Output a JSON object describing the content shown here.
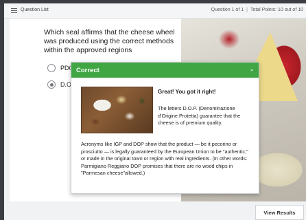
{
  "header": {
    "question_list_label": "Question List",
    "question_counter": "Question 1 of 1",
    "total_points": "Total Points: 10 out of 10"
  },
  "question": {
    "text": "Which seal affirms that the cheese wheel was produced using the correct methods within the approved regions",
    "options": [
      {
        "label": "PDO",
        "selected": false
      },
      {
        "label": "D.O.P.",
        "selected": true
      }
    ]
  },
  "feedback": {
    "status": "Correct",
    "title": "Great! You got it right!",
    "paragraph1": "The letters D.O.P. (Denominazione d'Origine Protetta) guarantee that the cheese is of premium quality.",
    "paragraph2": "Acronyms like IGP and DOP show that the product — be it pecorino or prosciutto — is legally guaranteed by the European Union to be \"authentic,\" or made in the original town or region with real ingredients. (In other words: Parmigiano Reggiano DOP promises that there are no wood chips in \"Parmesan cheese\"allowed.)",
    "accent_color": "#40a644"
  },
  "footer": {
    "view_results_label": "View Results"
  }
}
